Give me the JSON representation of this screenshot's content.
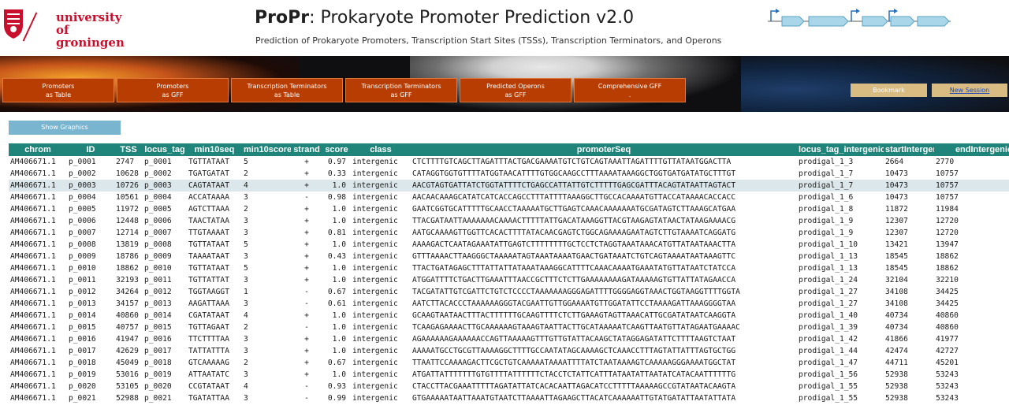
{
  "header": {
    "logo_line1": "university of",
    "logo_line2": "groningen",
    "title_bold": "ProPr",
    "title_rest": ": Prokaryote Promoter Prediction v2.0",
    "subtitle": "Prediction of Prokaryote Promoters, Transcription Start Sites (TSSs), Transcription Terminators, and Operons"
  },
  "colors": {
    "nav_button": "#b73d03",
    "table_header": "#1f8479",
    "selected_row": "#dbe7ea",
    "show_graphics": "#7ab5d0",
    "bookmark": "#d8bc82",
    "brand_red": "#c8102e",
    "operon_arrow": "#a9d6e8"
  },
  "nav": [
    {
      "line1": "Promoters",
      "line2": "as Table"
    },
    {
      "line1": "Promoters",
      "line2": "as GFF"
    },
    {
      "line1": "Transcription Terminators",
      "line2": "as Table"
    },
    {
      "line1": "Transcription Terminators",
      "line2": "as GFF"
    },
    {
      "line1": "Predicted Operons",
      "line2": "as GFF"
    },
    {
      "line1": "Comprehensive GFF",
      "line2": "."
    }
  ],
  "session": {
    "bookmark_label": "Bookmark",
    "new_session_label": "New Session"
  },
  "show_graphics_label": "Show Graphics",
  "table": {
    "columns": [
      "chrom",
      "ID",
      "TSS",
      "locus_tag",
      "min10seq",
      "min10score",
      "strand",
      "score",
      "class",
      "promoterSeq",
      "locus_tag_intergenic",
      "startIntergenic",
      "endIntergenic"
    ],
    "selected_row": 2,
    "rows": [
      [
        "AM406671.1",
        "p_0001",
        "2747",
        "p_0001",
        "TGTTATAAT",
        "5",
        "+",
        "0.97",
        "intergenic",
        "CTCTTTTGTCAGCTTAGATTTACTGACGAAAATGTCTGTCAGTAAATTAGATTTTGTTATAATGGACTTA",
        "prodigal_1_3",
        "2664",
        "2770"
      ],
      [
        "AM406671.1",
        "p_0002",
        "10628",
        "p_0002",
        "TGATGATAT",
        "2",
        "+",
        "0.33",
        "intergenic",
        "CATAGGTGGTGTTTTATGGTAACATTTTGTGGCAAGCCTTTAAAATAAAGGCTGGTGATGATATGCTTTGT",
        "prodigal_1_7",
        "10473",
        "10757"
      ],
      [
        "AM406671.1",
        "p_0003",
        "10726",
        "p_0003",
        "CAGTATAAT",
        "4",
        "+",
        "1.0",
        "intergenic",
        "AACGTAGTGATTATCTGGTATTTTCTGAGCCATTATTGTCTTTTTGAGCGATTTACAGTATAATTAGTACT",
        "prodigal_1_7",
        "10473",
        "10757"
      ],
      [
        "AM406671.1",
        "p_0004",
        "10561",
        "p_0004",
        "ACCATAAAA",
        "3",
        "-",
        "0.98",
        "intergenic",
        "AACAACAAAGCATATCATCACCAGCCTTTATTTTAAAGGCTTGCCACAAAATGTTACCATAAAACACCACC",
        "prodigal_1_6",
        "10473",
        "10757"
      ],
      [
        "AM406671.1",
        "p_0005",
        "11972",
        "p_0005",
        "AGTCTTAAA",
        "2",
        "+",
        "1.0",
        "intergenic",
        "GAATCGGTGCATTTTTGCAACCTAAAAATGCTTGAGTCAAACAAAAAAATGCGATAGTCTTAAAGCATGAA",
        "prodigal_1_8",
        "11872",
        "11984"
      ],
      [
        "AM406671.1",
        "p_0006",
        "12448",
        "p_0006",
        "TAACTATAA",
        "3",
        "+",
        "1.0",
        "intergenic",
        "TTACGATAATTAAAAAAACAAAACTTTTTATTGACATAAAGGTTACGTAAGAGTATAACTATAAGAAAACG",
        "prodigal_1_9",
        "12307",
        "12720"
      ],
      [
        "AM406671.1",
        "p_0007",
        "12714",
        "p_0007",
        "TTGTAAAAT",
        "3",
        "+",
        "0.81",
        "intergenic",
        "AATGCAAAAGTTGGTTCACACTTTTATACAACGAGTCTGGCAGAAAAGAATAGTCTTGTAAAATCAGGATG",
        "prodigal_1_9",
        "12307",
        "12720"
      ],
      [
        "AM406671.1",
        "p_0008",
        "13819",
        "p_0008",
        "TGTTATAAT",
        "5",
        "+",
        "1.0",
        "intergenic",
        "AAAAGACTCAATAGAAATATTGAGTCTTTTTTTTGCTCCTCTAGGTAAATAAACATGTTATAATAAACTTA",
        "prodigal_1_10",
        "13421",
        "13947"
      ],
      [
        "AM406671.1",
        "p_0009",
        "18786",
        "p_0009",
        "TAAAATAAT",
        "3",
        "+",
        "0.43",
        "intergenic",
        "GTTTAAAACTTAAGGGCTAAAAATAGTAAATAAAATGAACTGATAAATCTGTCAGTAAAATAATAAAGTTC",
        "prodigal_1_13",
        "18545",
        "18862"
      ],
      [
        "AM406671.1",
        "p_0010",
        "18862",
        "p_0010",
        "TGTTATAAT",
        "5",
        "+",
        "1.0",
        "intergenic",
        "TTACTGATAGAGCTTTATTATTATAAATAAAGGCATTTTCAAACAAAATGAAATATGTTATAATCTATCCA",
        "prodigal_1_13",
        "18545",
        "18862"
      ],
      [
        "AM406671.1",
        "p_0011",
        "32193",
        "p_0011",
        "TGTTATTAT",
        "3",
        "+",
        "1.0",
        "intergenic",
        "ATGGATTTTCTGACTTGAAATTTAACCGCTTTCTCTTGAAAAAAAAGATAAAAAGTGTTATTATAGAACCA",
        "prodigal_1_24",
        "32104",
        "32210"
      ],
      [
        "AM406671.1",
        "p_0012",
        "34264",
        "p_0012",
        "TGGTAAGGT",
        "1",
        "-",
        "0.67",
        "intergenic",
        "TACGATATTGTCGATTCTGTCTCCCCTAAAAAAAGGGAGATTTTGGGGAGGTAAACTGGTAAGGTTTTGGTA",
        "prodigal_1_27",
        "34108",
        "34425"
      ],
      [
        "AM406671.1",
        "p_0013",
        "34157",
        "p_0013",
        "AAGATTAAA",
        "3",
        "-",
        "0.61",
        "intergenic",
        "AATCTTACACCCTAAAAAAGGGTACGAATTGTTGGAAAATGTTGGATATTCCTAAAAGATTAAAGGGGTAA",
        "prodigal_1_27",
        "34108",
        "34425"
      ],
      [
        "AM406671.1",
        "p_0014",
        "40860",
        "p_0014",
        "CGATATAAT",
        "4",
        "+",
        "1.0",
        "intergenic",
        "GCAAGTAATAACTTTACTTTTTTGCAAGTTTTCTCTTGAAAGTAGTTAAACATTGCGATATAATCAAGGTA",
        "prodigal_1_40",
        "40734",
        "40860"
      ],
      [
        "AM406671.1",
        "p_0015",
        "40757",
        "p_0015",
        "TGTTAGAAT",
        "2",
        "-",
        "1.0",
        "intergenic",
        "TCAAGAGAAAACTTGCAAAAAAGTAAAGTAATTACTTGCATAAAAATCAAGTTAATGTTATAGAATGAAAAC",
        "prodigal_1_39",
        "40734",
        "40860"
      ],
      [
        "AM406671.1",
        "p_0016",
        "41947",
        "p_0016",
        "TTCTTTTAA",
        "3",
        "+",
        "1.0",
        "intergenic",
        "AGAAAAAAGAAAAAACCAGTTAAAAAGTTTGTTGTATTACAAGCTATAGGAGATATTCTTTTAAGTCTAAT",
        "prodigal_1_42",
        "41866",
        "41977"
      ],
      [
        "AM406671.1",
        "p_0017",
        "42629",
        "p_0017",
        "TATTATTTA",
        "3",
        "+",
        "1.0",
        "intergenic",
        "AAAAATGCCTGCGTTAAAAGGCTTTTGCCAATATAGCAAAAGCTCAAACCTTTAGTATTATTTAGTGCTGG",
        "prodigal_1_44",
        "42474",
        "42727"
      ],
      [
        "AM406671.1",
        "p_0018",
        "45049",
        "p_0018",
        "GTCAAAAAG",
        "2",
        "+",
        "0.67",
        "intergenic",
        "TTAATTCCAAAAGACTTCGCTGTCAAAAATAAAATTTTATCTAATAAAAGTCAAAAAGGGAAAATGGCTAT",
        "prodigal_1_47",
        "44711",
        "45201"
      ],
      [
        "AM406671.1",
        "p_0019",
        "53016",
        "p_0019",
        "ATTAATATC",
        "3",
        "+",
        "1.0",
        "intergenic",
        "ATGATTATTTTTTTGTGTTTTATTTTTTCTACCTCTATTCATTTATAATATTAATATCATACAATTTTTTG",
        "prodigal_1_56",
        "52938",
        "53243"
      ],
      [
        "AM406671.1",
        "p_0020",
        "53105",
        "p_0020",
        "CCGTATAAT",
        "4",
        "-",
        "0.93",
        "intergenic",
        "CTACCTTACGAAATTTTTAGATATTATCACACAATTAGACATCCTTTTTAAAAAGCCGTATAATACAAGTA",
        "prodigal_1_55",
        "52938",
        "53243"
      ],
      [
        "AM406671.1",
        "p_0021",
        "52988",
        "p_0021",
        "TGATATTAA",
        "3",
        "-",
        "0.99",
        "intergenic",
        "GTGAAAAATAATTAAATGTAATCTTAAAATTAGAAGCTTACATCAAAAAATTGTATGATATTAATATTATA",
        "prodigal_1_55",
        "52938",
        "53243"
      ]
    ]
  }
}
